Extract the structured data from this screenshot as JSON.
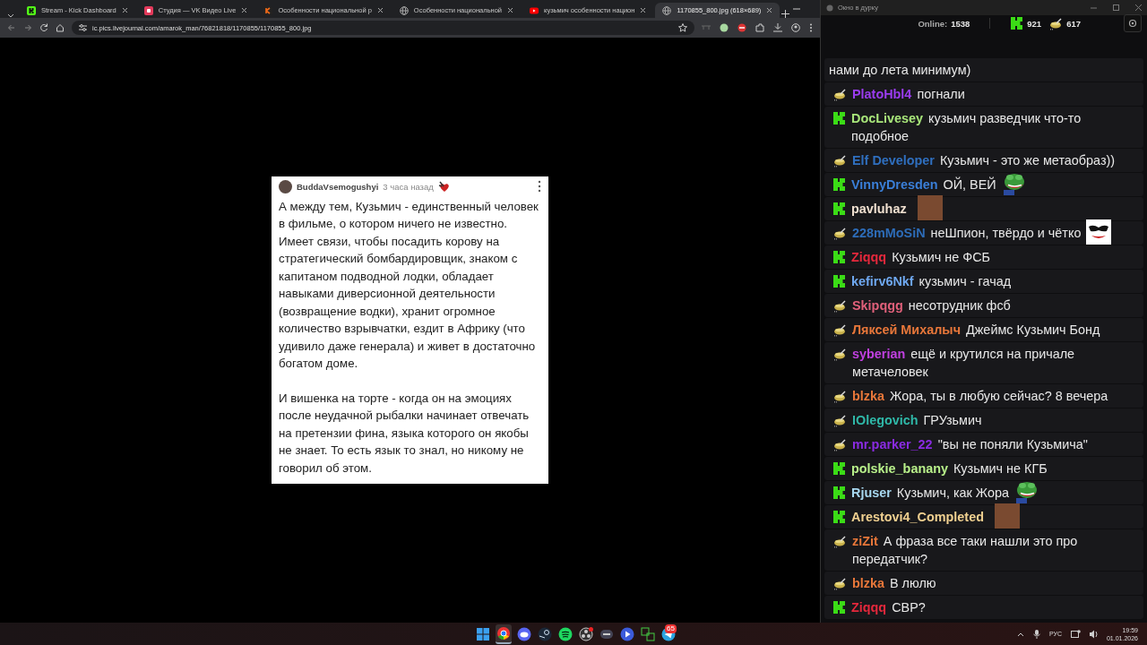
{
  "browser": {
    "tabs": [
      {
        "title": "Stream - Kick Dashboard",
        "kind": "kick",
        "selected": false
      },
      {
        "title": "Студия — VK Видео Live",
        "kind": "vk",
        "selected": false
      },
      {
        "title": "Особенности национальной р",
        "kind": "orange",
        "selected": false
      },
      {
        "title": "Особенности национальной",
        "kind": "globe",
        "selected": false
      },
      {
        "title": "кузьмич особенности национ",
        "kind": "youtube",
        "selected": false
      },
      {
        "title": "1170855_800.jpg (618×689)",
        "kind": "globe",
        "selected": true
      }
    ],
    "address": "ic.pics.livejournal.com/amarok_man/76821818/1170855/1170855_800.jpg",
    "post": {
      "author": "BuddaVsemogushyi",
      "time": "3 часа назад",
      "paragraphs": [
        "А между тем, Кузьмич - единственный человек в фильме, о котором ничего не известно. Имеет связи, чтобы посадить корову на стратегический бомбардировщик, знаком с капитаном подводной лодки, обладает навыками диверсионной деятельности (возвращение водки), хранит огромное количество взрывчатки, ездит в Африку (что удивило даже генерала) и живет в достаточно богатом доме.",
        "И вишенка на торте - когда он на эмоциях после неудачной рыбалки начинает отвечать на претензии фина, языка которого он якобы не знает. То есть язык то знал, но никому не говорил об этом."
      ]
    }
  },
  "chat": {
    "title": "Окно в дурку",
    "online_label": "Online:",
    "online": "1538",
    "kick_count": "921",
    "bowl_count": "617",
    "messages": [
      {
        "kind": "continuation",
        "text": "нами до лета минимум)"
      },
      {
        "kind": "bowl",
        "user": "PlatoHbl4",
        "color": "#9b3cf0",
        "text": "погнали"
      },
      {
        "kind": "kick",
        "user": "DocLivesey",
        "color": "#a8e67a",
        "text": "кузьмич разведчик что-то подобное"
      },
      {
        "kind": "bowl",
        "user": "Elf Developer",
        "color": "#2f6fbf",
        "text": "Кузьмич - это же метаобраз))"
      },
      {
        "kind": "kick",
        "user": "VinnyDresden",
        "color": "#3a7fd8",
        "text": "ОЙ, ВЕЙ",
        "emote": {
          "kind": "frog"
        }
      },
      {
        "kind": "kick",
        "user": "pavluhaz",
        "color": "#f0e0d0",
        "emote": {
          "kind": "photo"
        }
      },
      {
        "kind": "bowl",
        "user": "228mMoSiN",
        "color": "#2d6cb8",
        "text": "неШпион, твёрдо и чётко",
        "emote": {
          "kind": "mask"
        }
      },
      {
        "kind": "kick",
        "user": "Ziqqq",
        "color": "#e5283c",
        "text": "Кузьмич не ФСБ"
      },
      {
        "kind": "kick",
        "user": "kefirv6Nkf",
        "color": "#6fa8f0",
        "text": "кузьмич - гачад"
      },
      {
        "kind": "bowl",
        "user": "Skipqgg",
        "color": "#e0607a",
        "text": "несотрудник фсб"
      },
      {
        "kind": "bowl",
        "user": "Ляксей Михалыч",
        "color": "#e8773a",
        "text": "Джеймс Кузьмич Бонд"
      },
      {
        "kind": "bowl",
        "user": "syberian",
        "color": "#c040e0",
        "text": "ещё и крутился на причале метачеловек"
      },
      {
        "kind": "bowl",
        "user": "blzka",
        "color": "#e8773a",
        "text": "Жора, ты в любую сейчас? 8 вечера"
      },
      {
        "kind": "bowl",
        "user": "IOlegovich",
        "color": "#2fb8a8",
        "text": "ГРУзьмич"
      },
      {
        "kind": "bowl",
        "user": "mr.parker_22",
        "color": "#8a2be2",
        "text": "\"вы не поняли Кузьмича\""
      },
      {
        "kind": "kick",
        "user": "polskie_banany",
        "color": "#b8f08a",
        "text": "Кузьмич не КГБ"
      },
      {
        "kind": "kick",
        "user": "Rjuser",
        "color": "#a8d8f0",
        "text": "Кузьмич, как Жора",
        "emote": {
          "kind": "frog"
        }
      },
      {
        "kind": "kick",
        "user": "Arestovi4_Completed",
        "color": "#f0d090",
        "emote": {
          "kind": "photo"
        }
      },
      {
        "kind": "bowl",
        "user": "ziZit",
        "color": "#e8773a",
        "text": "А фраза все таки нашли это про передатчик?"
      },
      {
        "kind": "bowl",
        "user": "blzka",
        "color": "#e8773a",
        "text": "В люлю"
      },
      {
        "kind": "kick",
        "user": "Ziqqq",
        "color": "#e5283c",
        "text": "СВР?"
      }
    ]
  },
  "taskbar": {
    "apps": [
      {
        "kind": "windows",
        "selected": false
      },
      {
        "kind": "chrome",
        "selected": true
      },
      {
        "kind": "discord",
        "selected": false
      },
      {
        "kind": "steam",
        "selected": false
      },
      {
        "kind": "spotify",
        "selected": false
      },
      {
        "kind": "obs",
        "selected": false
      },
      {
        "kind": "media",
        "selected": false
      },
      {
        "kind": "play",
        "selected": false
      },
      {
        "kind": "snip",
        "selected": false
      },
      {
        "kind": "telegram",
        "selected": false,
        "badge": "65"
      }
    ],
    "language": "РУС",
    "time": "19:59",
    "date": "01.01.2026"
  }
}
